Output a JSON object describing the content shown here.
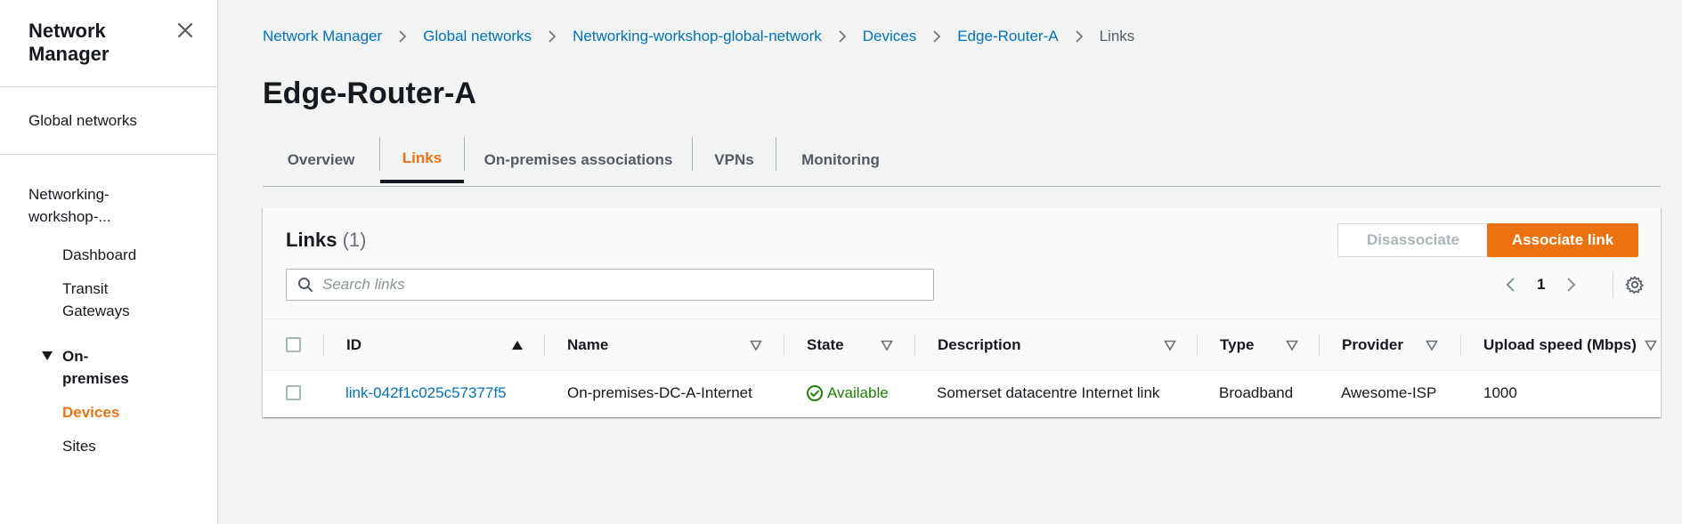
{
  "sidebar": {
    "title": "Network Manager",
    "items": {
      "global_networks": "Global networks",
      "network_name": "Networking-workshop-...",
      "dashboard": "Dashboard",
      "transit_gateways": "Transit Gateways",
      "on_premises": "On-premises",
      "devices": "Devices",
      "sites": "Sites"
    }
  },
  "breadcrumb": [
    "Network Manager",
    "Global networks",
    "Networking-workshop-global-network",
    "Devices",
    "Edge-Router-A",
    "Links"
  ],
  "page_title": "Edge-Router-A",
  "tabs": [
    "Overview",
    "Links",
    "On-premises associations",
    "VPNs",
    "Monitoring"
  ],
  "active_tab": "Links",
  "panel": {
    "title": "Links",
    "count": "(1)",
    "disassociate_label": "Disassociate",
    "associate_label": "Associate link",
    "search_placeholder": "Search links",
    "page_number": "1"
  },
  "table": {
    "columns": [
      "ID",
      "Name",
      "State",
      "Description",
      "Type",
      "Provider",
      "Upload speed (Mbps)"
    ],
    "rows": [
      {
        "id": "link-042f1c025c57377f5",
        "name": "On-premises-DC-A-Internet",
        "state": "Available",
        "description": "Somerset datacentre Internet link",
        "type": "Broadband",
        "provider": "Awesome-ISP",
        "upload_speed": "1000"
      }
    ]
  },
  "colors": {
    "accent": "#ec7211",
    "link": "#0073bb",
    "success": "#1d8102"
  }
}
